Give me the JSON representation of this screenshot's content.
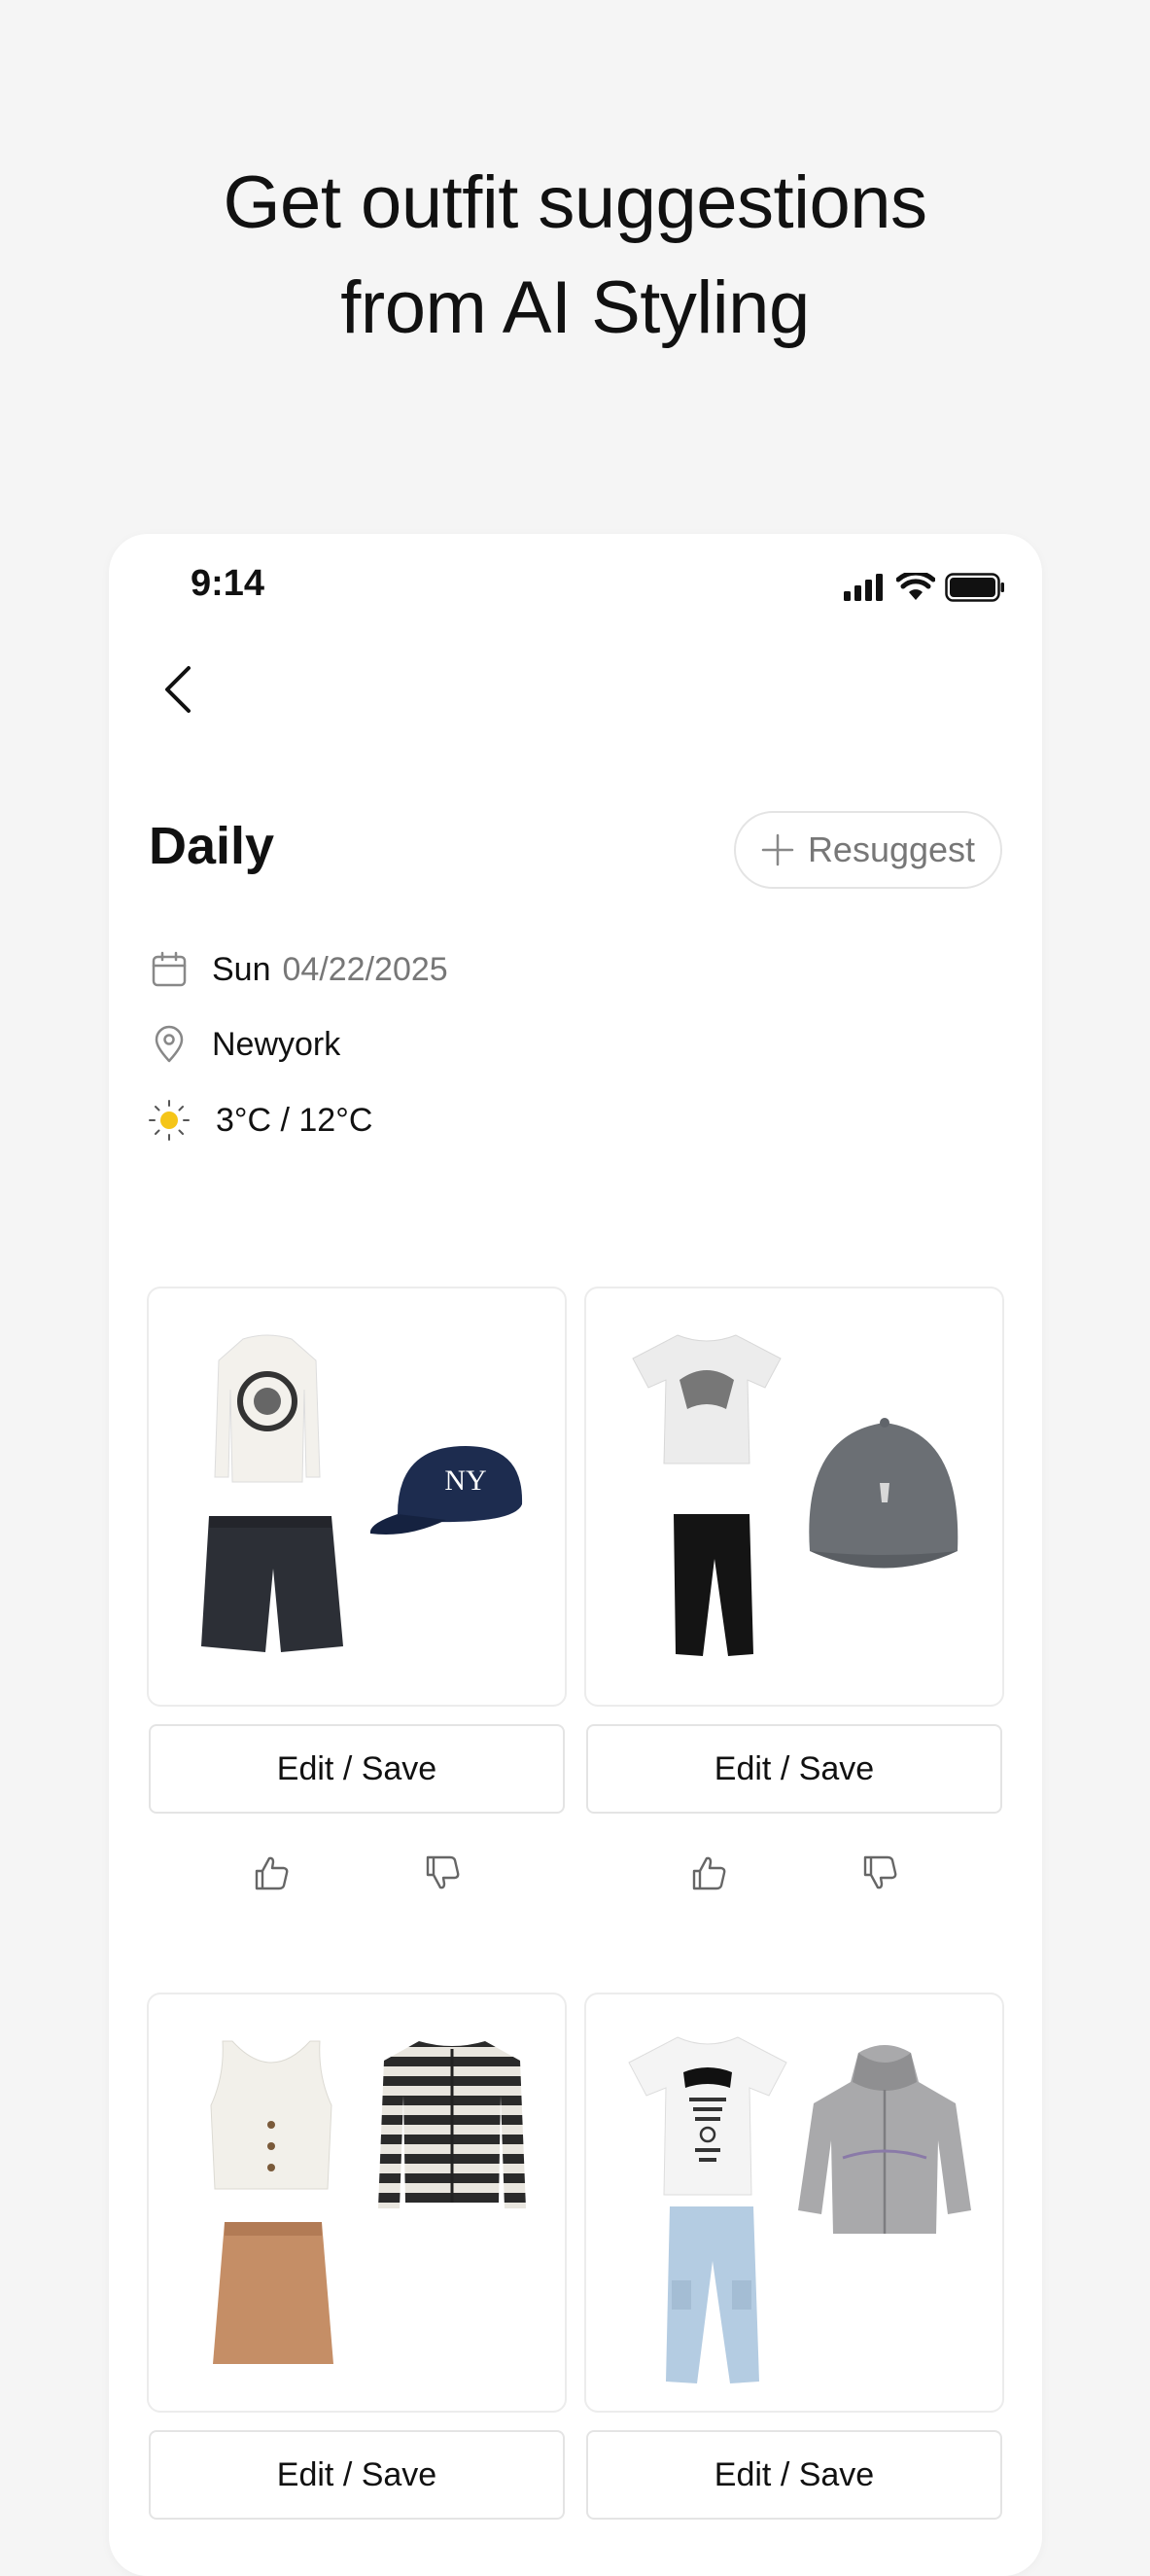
{
  "headline": {
    "line1": "Get outfit suggestions",
    "line2": "from AI Styling"
  },
  "status_bar": {
    "time": "9:14",
    "icons": [
      "cellular-signal-icon",
      "wifi-icon",
      "battery-icon"
    ]
  },
  "header": {
    "back_icon": "chevron-left-icon",
    "title": "Daily",
    "resuggest_label": "Resuggest",
    "resuggest_icon": "plus-icon"
  },
  "info": {
    "day": "Sun",
    "date": "04/22/2025",
    "location": "Newyork",
    "temperature": "3°C / 12°C",
    "icons": {
      "date": "calendar-icon",
      "location": "map-pin-icon",
      "weather": "sun-icon"
    }
  },
  "outfits": [
    {
      "items": [
        "cream sweater with graphic",
        "dark grey pleated shorts",
        "navy NY baseball cap"
      ],
      "edit_label": "Edit / Save"
    },
    {
      "items": [
        "white graphic t-shirt",
        "black sweatpants",
        "grey polo cap"
      ],
      "edit_label": "Edit / Save"
    },
    {
      "items": [
        "white button tank top",
        "black and white striped cardigan",
        "tan mini skirt"
      ],
      "edit_label": "Edit / Save"
    },
    {
      "items": [
        "white logo t-shirt",
        "light blue cargo jeans",
        "grey zip hoodie"
      ],
      "edit_label": "Edit / Save"
    }
  ],
  "colors": {
    "background": "#f5f5f5",
    "card": "#ffffff",
    "border": "#e4e4e4",
    "muted_text": "#777777",
    "sun": "#f5c518"
  }
}
